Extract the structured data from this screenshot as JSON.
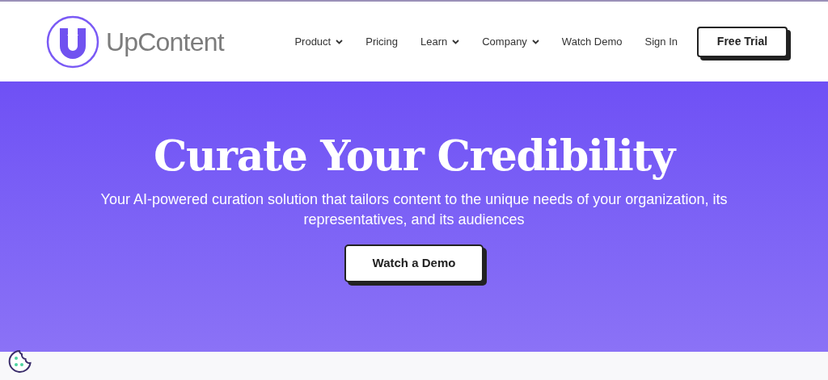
{
  "logo": {
    "text": "UpContent"
  },
  "nav": [
    {
      "label": "Product",
      "has_menu": true
    },
    {
      "label": "Pricing",
      "has_menu": false
    },
    {
      "label": "Learn",
      "has_menu": true
    },
    {
      "label": "Company",
      "has_menu": true
    },
    {
      "label": "Watch Demo",
      "has_menu": false
    },
    {
      "label": "Sign In",
      "has_menu": false
    }
  ],
  "cta": "Free Trial",
  "hero": {
    "title": "Curate Your Credibility",
    "subtitle": "Your AI-powered curation solution that tailors content to the unique needs of your organization, its representatives, and its audiences",
    "button": "Watch a Demo"
  }
}
